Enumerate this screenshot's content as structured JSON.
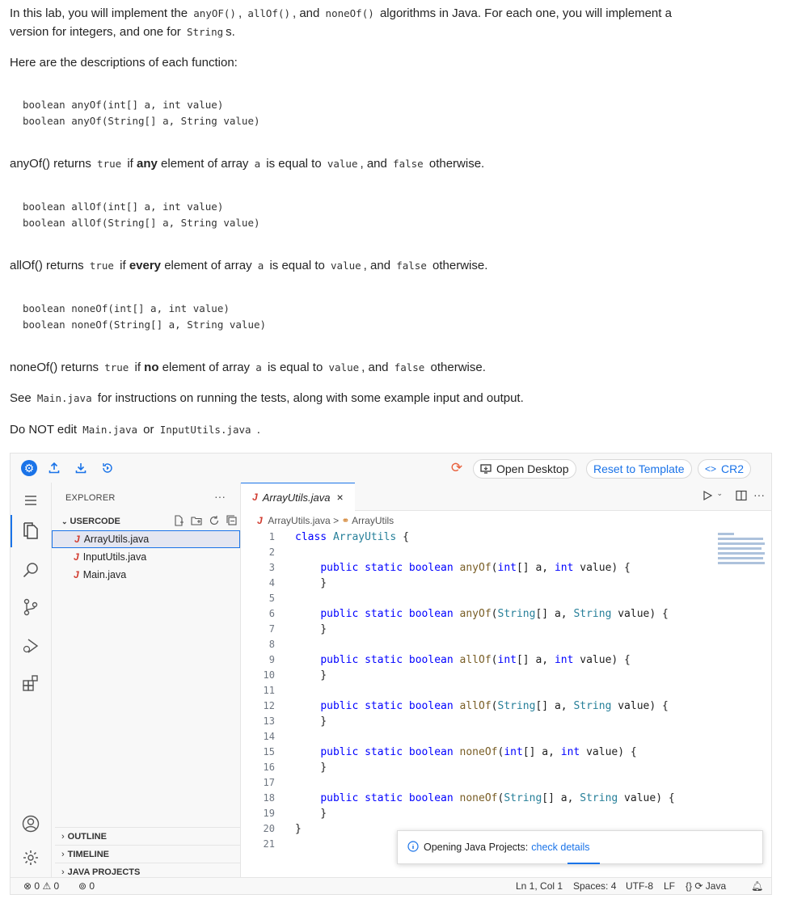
{
  "instructions": {
    "intro_a": "In this lab, you will implement the",
    "intro_code1": "anyOF()",
    "intro_comma1": ",",
    "intro_code2": "allOf()",
    "intro_and": ", and",
    "intro_code3": "noneOf()",
    "intro_b": "algorithms in Java. For each one, you will implement a",
    "intro_line2": "version for integers, and one for",
    "intro_code4": "String",
    "intro_s": "s.",
    "desc_heading": "Here are the descriptions of each function:",
    "anyof_sig1": "boolean anyOf(int[] a, int value)",
    "anyof_sig2": "boolean anyOf(String[] a, String value)",
    "anyof_text1": "anyOf() returns",
    "anyof_true": "true",
    "anyof_text2": "if",
    "anyof_bold": "any",
    "anyof_text3": "element of array",
    "anyof_a": "a",
    "anyof_text4": "is equal to",
    "anyof_value": "value",
    "anyof_text5": ", and",
    "anyof_false": "false",
    "anyof_text6": "otherwise.",
    "allof_sig1": "boolean allOf(int[] a, int value)",
    "allof_sig2": "boolean allOf(String[] a, String value)",
    "allof_text1": "allOf() returns",
    "allof_true": "true",
    "allof_text2": "if",
    "allof_bold": "every",
    "allof_text3": "element of array",
    "allof_a": "a",
    "allof_text4": "is equal to",
    "allof_value": "value",
    "allof_text5": ", and",
    "allof_false": "false",
    "allof_text6": "otherwise.",
    "noneof_sig1": "boolean noneOf(int[] a, int value)",
    "noneof_sig2": "boolean noneOf(String[] a, String value)",
    "noneof_text1": "noneOf() returns",
    "noneof_true": "true",
    "noneof_text2": "if",
    "noneof_bold": "no",
    "noneof_text3": "element of array",
    "noneof_a": "a",
    "noneof_text4": "is equal to",
    "noneof_value": "value",
    "noneof_text5": ", and",
    "noneof_false": "false",
    "noneof_text6": "otherwise.",
    "see_text1": "See",
    "see_code": "Main.java",
    "see_text2": "for instructions on running the tests, along with some example input and output.",
    "donot_text1": "Do NOT edit",
    "donot_code1": "Main.java",
    "donot_or": "or",
    "donot_code2": "InputUtils.java",
    "donot_period": "."
  },
  "toolbar": {
    "open_desktop": "Open Desktop",
    "reset": "Reset to Template",
    "cr2": "CR2",
    "cr2_glyph": "<>"
  },
  "explorer": {
    "title": "EXPLORER",
    "dots": "···",
    "section": "USERCODE",
    "files": [
      "ArrayUtils.java",
      "InputUtils.java",
      "Main.java"
    ],
    "j_glyph": "J",
    "outline": "OUTLINE",
    "timeline": "TIMELINE",
    "java_projects": "JAVA PROJECTS"
  },
  "editor": {
    "tab_label": "ArrayUtils.java",
    "tab_close": "×",
    "breadcrumb_file": "ArrayUtils.java",
    "breadcrumb_sep": ">",
    "breadcrumb_class": "ArrayUtils",
    "line_numbers": [
      "1",
      "2",
      "3",
      "4",
      "5",
      "6",
      "7",
      "8",
      "9",
      "10",
      "11",
      "12",
      "13",
      "14",
      "15",
      "16",
      "17",
      "18",
      "19",
      "20",
      "21"
    ],
    "lines": [
      "class ArrayUtils {",
      "",
      "    public static boolean anyOf(int[] a, int value) {",
      "    }",
      "",
      "    public static boolean anyOf(String[] a, String value) {",
      "    }",
      "",
      "    public static boolean allOf(int[] a, int value) {",
      "    }",
      "",
      "    public static boolean allOf(String[] a, String value) {",
      "    }",
      "",
      "    public static boolean noneOf(int[] a, int value) {",
      "    }",
      "",
      "    public static boolean noneOf(String[] a, String value) {",
      "    }",
      "}",
      ""
    ]
  },
  "notification": {
    "text": "Opening Java Projects:",
    "link": "check details"
  },
  "statusbar": {
    "errors": "0",
    "warnings": "0",
    "ports": "0",
    "position": "Ln 1, Col 1",
    "spaces": "Spaces: 4",
    "encoding": "UTF-8",
    "eol": "LF",
    "lang_braces": "{}",
    "language": "Java"
  },
  "colors": {
    "accent": "#1a73e8",
    "keyword": "#0000ff",
    "type": "#267f99",
    "function": "#795e26",
    "java_icon": "#d13b2f",
    "sync_icon": "#e8603c"
  }
}
